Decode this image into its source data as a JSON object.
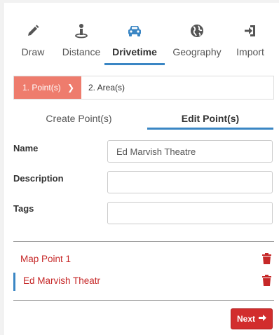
{
  "nav": {
    "items": [
      {
        "label": "Draw",
        "icon": "pencil-icon"
      },
      {
        "label": "Distance",
        "icon": "person-pin-icon"
      },
      {
        "label": "Drivetime",
        "icon": "car-icon"
      },
      {
        "label": "Geography",
        "icon": "globe-icon"
      },
      {
        "label": "Import",
        "icon": "import-icon"
      }
    ],
    "active": "Drivetime",
    "accent": "#3a86c4"
  },
  "stepper": {
    "step1": "1. Point(s)",
    "step2": "2. Area(s)",
    "active_color": "#ee7c6d"
  },
  "subtabs": {
    "create": "Create Point(s)",
    "edit": "Edit Point(s)",
    "active": "Edit Point(s)"
  },
  "form": {
    "name_label": "Name",
    "name_value": "Ed Marvish Theatre",
    "description_label": "Description",
    "description_value": "",
    "tags_label": "Tags",
    "tags_value": ""
  },
  "points": [
    {
      "name": "Map Point 1",
      "selected": false
    },
    {
      "name": "Ed Marvish Theatr",
      "selected": true
    }
  ],
  "list_color": "#c62828",
  "next_button": {
    "label": "Next",
    "color": "#d22d2d"
  }
}
